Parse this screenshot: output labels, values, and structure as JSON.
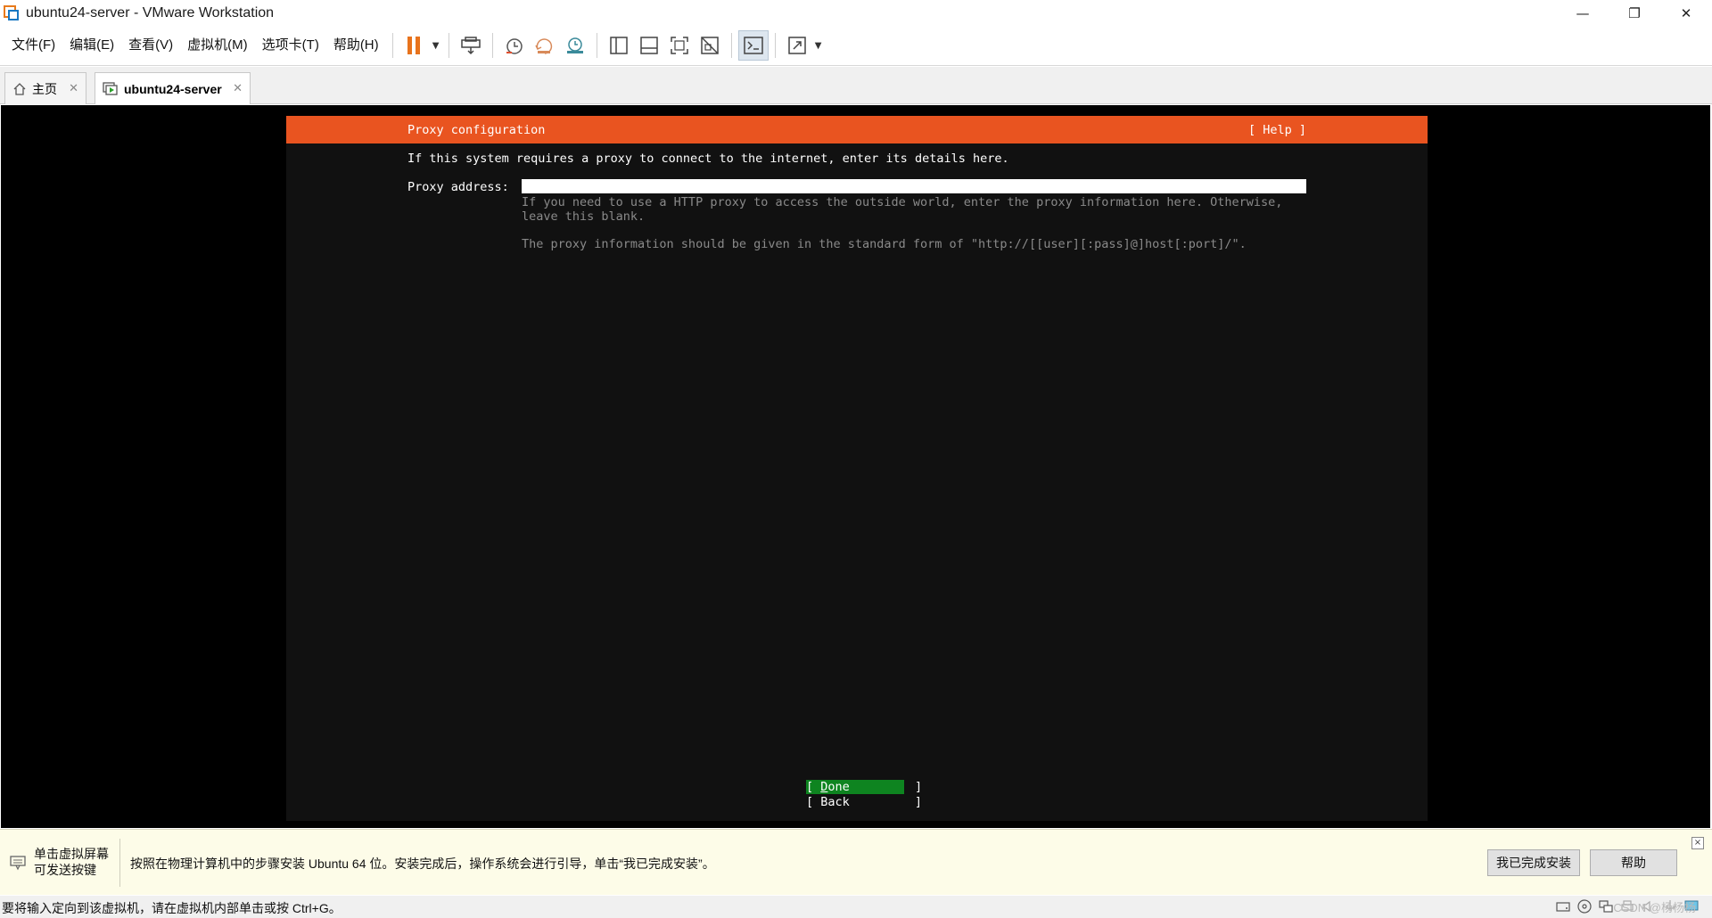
{
  "window": {
    "title": "ubuntu24-server - VMware Workstation",
    "minimize": "—",
    "maximize": "❐",
    "close": "✕"
  },
  "menu": {
    "items": [
      "文件(F)",
      "编辑(E)",
      "查看(V)",
      "虚拟机(M)",
      "选项卡(T)",
      "帮助(H)"
    ]
  },
  "toolbar": {
    "icons": [
      "pause-icon",
      "send-keys-icon",
      "snapshot-icon",
      "revert-snapshot-icon",
      "snapshot-manager-icon",
      "sidebar-icon",
      "thumbnail-bar-icon",
      "fullscreen-icon",
      "unity-icon",
      "console-icon",
      "stretch-icon"
    ],
    "accent": "#e8731d"
  },
  "tabs": [
    {
      "label": "主页",
      "icon": "home-icon"
    },
    {
      "label": "ubuntu24-server",
      "icon": "vm-running-icon"
    }
  ],
  "installer": {
    "title": "Proxy configuration",
    "help": "[ Help ]",
    "intro": "If this system requires a proxy to connect to the internet, enter its details here.",
    "proxy_label": "Proxy address:",
    "proxy_value": "",
    "help_text_1": "If you need to use a HTTP proxy to access the outside world, enter the proxy information here. Otherwise, leave this blank.",
    "help_text_2": "The proxy information should be given in the standard form of \"http://[[user][:pass]@]host[:port]/\".",
    "done_open": "[ ",
    "done_hotkey": "D",
    "done_rest": "one",
    "done_close": "         ]",
    "back_label": "[ Back         ]",
    "header_color": "#e95420",
    "done_color": "#0e8420"
  },
  "hint": {
    "left_line1": "单击虚拟屏幕",
    "left_line2": "可发送按键",
    "message": "按照在物理计算机中的步骤安装 Ubuntu 64 位。安装完成后，操作系统会进行引导，单击“我已完成安装”。",
    "done_button": "我已完成安装",
    "help_button": "帮助",
    "close": "×"
  },
  "status": {
    "text": "要将输入定向到该虚拟机，请在虚拟机内部单击或按 Ctrl+G。",
    "watermark": "CSDN @杨杨杨",
    "icons": [
      "hdd-icon",
      "cdrom-icon",
      "network-icon",
      "printer-icon",
      "sound-icon",
      "usb-icon",
      "display-icon"
    ]
  }
}
